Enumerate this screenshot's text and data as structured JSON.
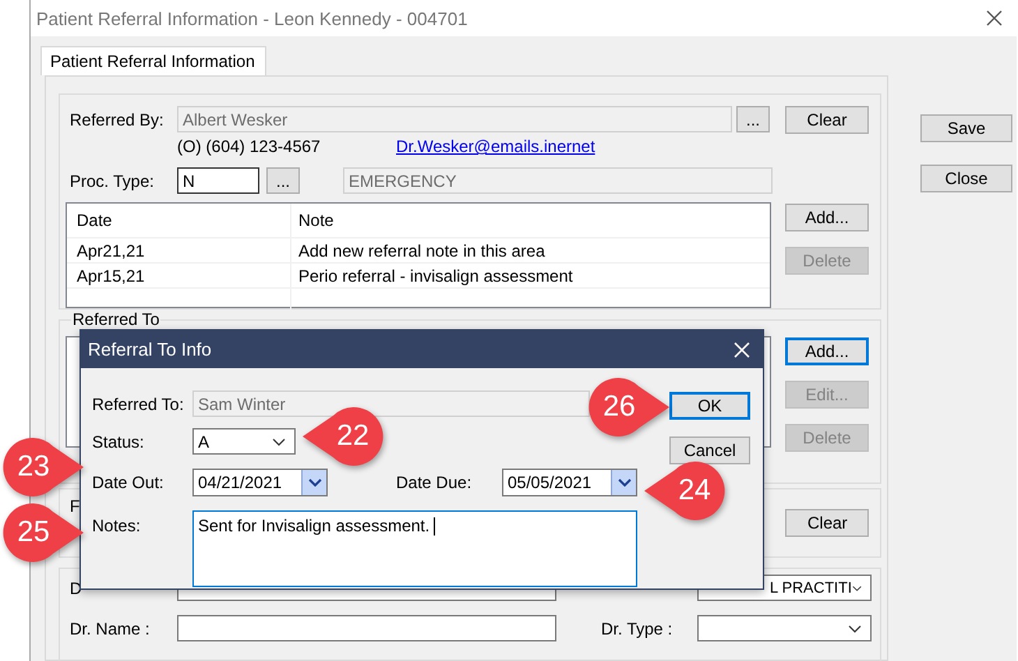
{
  "window": {
    "title": "Patient Referral Information - Leon Kennedy - 004701"
  },
  "tabs": [
    {
      "label": "Patient Referral Information",
      "selected": true
    }
  ],
  "referred_by": {
    "label": "Referred By:",
    "value": "Albert Wesker",
    "browse": "...",
    "clear": "Clear",
    "phone": "(O) (604) 123-4567",
    "email": "Dr.Wesker@emails.inernet"
  },
  "proc_type": {
    "label": "Proc. Type:",
    "value": "N",
    "browse": "...",
    "description": "EMERGENCY"
  },
  "notes_table": {
    "columns": [
      "Date",
      "Note"
    ],
    "rows": [
      [
        "Apr21,21",
        "Add new referral note in this area"
      ],
      [
        "Apr15,21",
        "Perio referral - invisalign assessment"
      ]
    ],
    "buttons": [
      {
        "label": "Add...",
        "disabled": false,
        "focused": false
      },
      {
        "label": "Delete",
        "disabled": true,
        "focused": false
      }
    ]
  },
  "referred_to": {
    "title": "Referred To",
    "buttons": [
      {
        "label": "Add...",
        "disabled": false,
        "focused": true
      },
      {
        "label": "Edit...",
        "disabled": true,
        "focused": false
      },
      {
        "label": "Delete",
        "disabled": true,
        "focused": false
      }
    ]
  },
  "section_3": {
    "label": "F",
    "clear": "Clear"
  },
  "section_4": {
    "label": "D",
    "combo": "L PRACTITI",
    "dr_name_label": "Dr. Name :",
    "dr_type_label": "Dr. Type :"
  },
  "side_buttons": [
    "Save",
    "Close"
  ],
  "dialog": {
    "title": "Referral To Info",
    "referred_to_label": "Referred To:",
    "referred_to": "Sam Winter",
    "status_label": "Status:",
    "status": "A",
    "date_out_label": "Date Out:",
    "date_out": "04/21/2021",
    "date_due_label": "Date Due:",
    "date_due": "05/05/2021",
    "notes_label": "Notes:",
    "notes": "Sent for Invisalign assessment.",
    "buttons": [
      {
        "label": "OK",
        "focused": true
      },
      {
        "label": "Cancel",
        "focused": false
      }
    ]
  },
  "callouts": [
    {
      "number": "26",
      "kind": "right"
    },
    {
      "number": "22",
      "kind": "left"
    },
    {
      "number": "23",
      "kind": "right"
    },
    {
      "number": "24",
      "kind": "left"
    },
    {
      "number": "25",
      "kind": "right"
    }
  ]
}
